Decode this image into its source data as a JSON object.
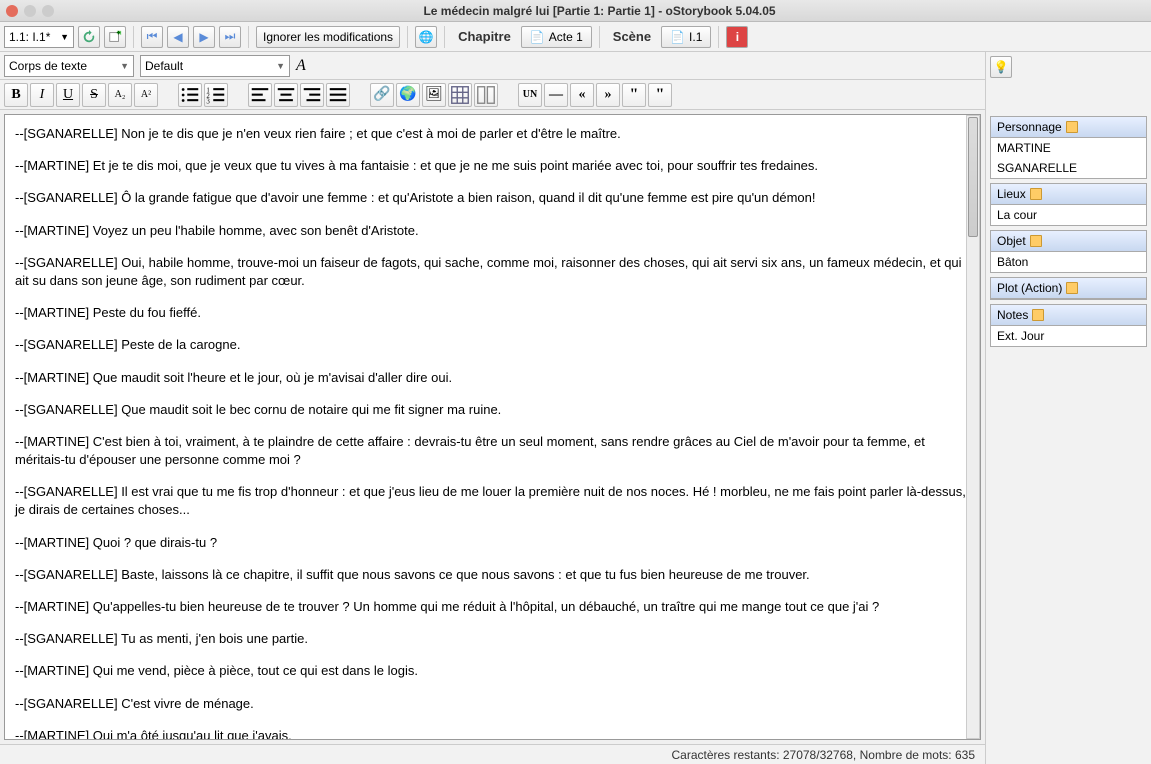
{
  "window": {
    "title": "Le médecin malgré lui [Partie 1: Partie 1] - oStorybook 5.04.05"
  },
  "toolbar": {
    "selector": "1.1: I.1*",
    "ignore": "Ignorer les modifications",
    "chapter_lbl": "Chapitre",
    "act": "Acte 1",
    "scene_lbl": "Scène",
    "scene": "I.1"
  },
  "fmt": {
    "style": "Corps de texte",
    "font": "Default"
  },
  "lines": [
    "--[SGANARELLE] Non je te dis que je n'en veux rien faire ; et que c'est à moi de parler et d'être le maître.",
    "--[MARTINE] Et je te dis moi, que je veux que tu vives à ma fantaisie : et que je ne me suis point mariée avec toi, pour souffrir tes fredaines.",
    "--[SGANARELLE] Ô la grande fatigue que d'avoir une femme : et qu'Aristote a bien raison, quand il dit qu'une femme est pire qu'un démon!",
    "--[MARTINE] Voyez un peu l'habile homme, avec son benêt d'Aristote.",
    "--[SGANARELLE] Oui, habile homme, trouve-moi un faiseur de fagots, qui sache, comme moi, raisonner des choses, qui ait servi six ans, un fameux médecin, et qui ait su dans son jeune âge, son rudiment par cœur.",
    "--[MARTINE] Peste du fou fieffé.",
    "--[SGANARELLE] Peste de la carogne.",
    "--[MARTINE] Que maudit soit l'heure et le jour, où je m'avisai d'aller dire oui.",
    "--[SGANARELLE] Que maudit soit le bec cornu de notaire qui me fit signer ma ruine.",
    "--[MARTINE] C'est bien à toi, vraiment, à te plaindre de cette affaire : devrais-tu être un seul moment, sans rendre grâces au Ciel de m'avoir pour ta femme, et méritais-tu d'épouser une personne comme moi ?",
    "--[SGANARELLE] Il est vrai que tu me fis trop d'honneur : et que j'eus lieu de me louer la première nuit de nos noces. Hé ! morbleu, ne me fais point parler là-dessus, je dirais de certaines choses...",
    "--[MARTINE] Quoi ? que dirais-tu ?",
    "--[SGANARELLE] Baste, laissons là ce chapitre, il suffit que nous savons ce que nous savons : et que tu fus bien heureuse de me trouver.",
    "--[MARTINE] Qu'appelles-tu bien heureuse de te trouver ? Un homme qui me réduit à l'hôpital, un débauché, un traître qui me mange tout ce que j'ai ?",
    "--[SGANARELLE] Tu as menti, j'en bois une partie.",
    "--[MARTINE] Qui me vend, pièce à pièce, tout ce qui est dans le logis.",
    "--[SGANARELLE] C'est vivre de ménage.",
    "--[MARTINE] Qui m'a ôté jusqu'au lit que j'avais."
  ],
  "status": "Caractères restants: 27078/32768, Nombre de mots: 635",
  "side": {
    "personnage": {
      "title": "Personnage",
      "items": [
        "MARTINE",
        "SGANARELLE"
      ]
    },
    "lieux": {
      "title": "Lieux",
      "items": [
        "La cour"
      ]
    },
    "objet": {
      "title": "Objet",
      "items": [
        "Bâton"
      ]
    },
    "plot": {
      "title": "Plot (Action)",
      "items": []
    },
    "notes": {
      "title": "Notes",
      "items": [
        "Ext. Jour"
      ]
    }
  }
}
